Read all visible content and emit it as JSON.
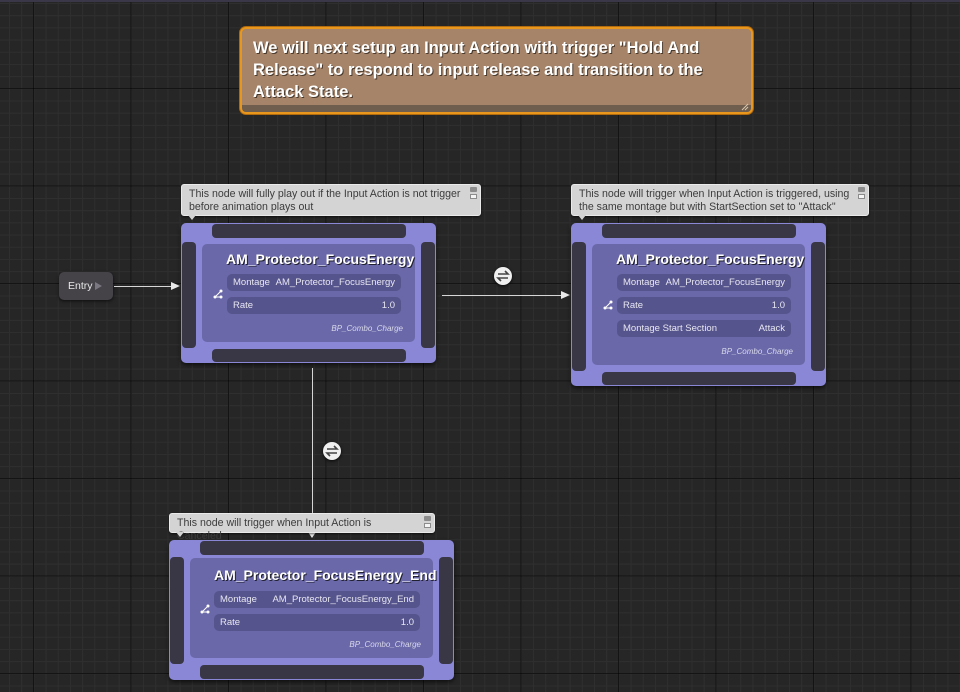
{
  "banner": {
    "text": "We will next setup an Input Action with trigger \"Hold And Release\" to respond to input release and transition to the Attack State."
  },
  "entry": {
    "label": "Entry"
  },
  "nodes": [
    {
      "comment": "This node will fully play out if the Input Action is not trigger before animation plays out",
      "title": "AM_Protector_FocusEnergy",
      "rows": [
        {
          "key": "Montage",
          "value": "AM_Protector_FocusEnergy"
        },
        {
          "key": "Rate",
          "value": "1.0"
        }
      ],
      "owner": "BP_Combo_Charge"
    },
    {
      "comment": "This node will trigger when Input Action is triggered, using the same montage but with StartSection set to \"Attack\"",
      "title": "AM_Protector_FocusEnergy",
      "rows": [
        {
          "key": "Montage",
          "value": "AM_Protector_FocusEnergy"
        },
        {
          "key": "Rate",
          "value": "1.0"
        },
        {
          "key": "Montage Start Section",
          "value": "Attack"
        }
      ],
      "owner": "BP_Combo_Charge"
    },
    {
      "comment": "This node will trigger when Input Action is Canceled",
      "title": "AM_Protector_FocusEnergy_End",
      "rows": [
        {
          "key": "Montage",
          "value": "AM_Protector_FocusEnergy_End"
        },
        {
          "key": "Rate",
          "value": "1.0"
        }
      ],
      "owner": "BP_Combo_Charge"
    }
  ],
  "transitions": [
    {
      "from": "AM_Protector_FocusEnergy",
      "to": "AM_Protector_FocusEnergy (Attack)",
      "icon": "transition-icon"
    },
    {
      "from": "AM_Protector_FocusEnergy",
      "to": "AM_Protector_FocusEnergy_End",
      "icon": "transition-icon"
    }
  ],
  "colors": {
    "banner_bg": "#a6846a",
    "banner_border": "#e8961c",
    "state_node": "#8a88d6",
    "state_inner": "#6a68a8",
    "background": "#262626"
  }
}
